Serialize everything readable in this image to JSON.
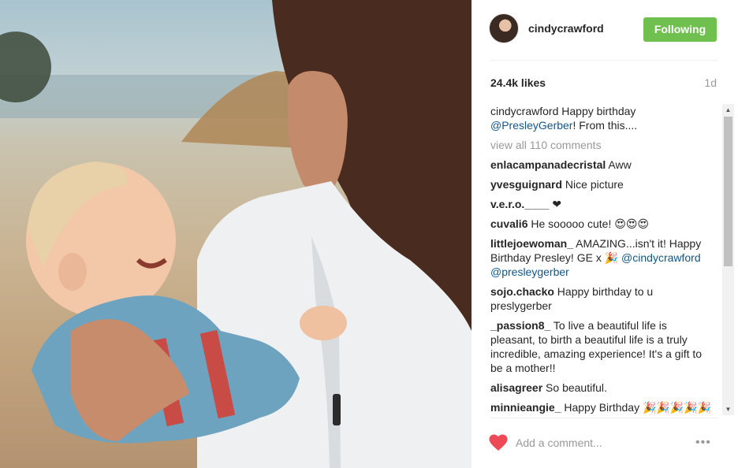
{
  "post": {
    "username": "cindycrawford",
    "follow_label": "Following",
    "likes": "24.4k likes",
    "age": "1d",
    "colors": {
      "follow_bg": "#70c050",
      "heart": "#ed4956",
      "mention": "#125688"
    },
    "caption": {
      "user": "cindycrawford",
      "text_before": " Happy birthday ",
      "mention": "@PresleyGerber",
      "text_after": "! From this...."
    },
    "view_all": "view all 110 comments",
    "comments": [
      {
        "user": "enlacampanadecristal",
        "text": " Aww"
      },
      {
        "user": "yvesguignard",
        "text": " Nice picture"
      },
      {
        "user": "v.e.r.o.____",
        "text": " ❤"
      },
      {
        "user": "cuvali6",
        "text": " He sooooo cute! 😍😍😍"
      },
      {
        "user": "littlejoewoman_",
        "text": " AMAZING...isn't it! Happy Birthday Presley! GE x 🎉 ",
        "mentions": "@cindycrawford @presleygerber"
      },
      {
        "user": "sojo.chacko",
        "text": " Happy birthday to u preslygerber"
      },
      {
        "user": "_passion8_",
        "text": " To live a beautiful life is pleasant, to birth a beautiful life is a truly incredible, amazing experience! It's a gift to be a mother!!"
      },
      {
        "user": "alisagreer",
        "text": " So beautiful."
      },
      {
        "user": "minnieangie_",
        "text": " Happy Birthday 🎉🎉🎉🎉🎉"
      }
    ],
    "add_comment_placeholder": "Add a comment...",
    "icons": {
      "like": "heart-icon",
      "more": "more-options-icon",
      "avatar": "profile-photo"
    }
  }
}
